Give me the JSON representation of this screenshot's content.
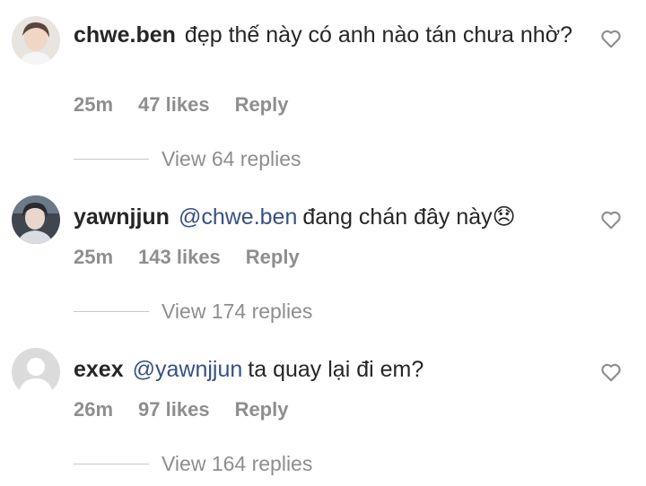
{
  "comments": [
    {
      "username": "chwe.ben",
      "mention": "",
      "text": "đẹp thế này có anh nào tán chưa nhờ?",
      "time": "25m",
      "likes": "47 likes",
      "reply": "Reply",
      "view_replies": "View 64 replies",
      "avatar_icon": "profile-photo"
    },
    {
      "username": "yawnjjun",
      "mention": "@chwe.ben",
      "text": "đang chán đây này😞",
      "time": "25m",
      "likes": "143 likes",
      "reply": "Reply",
      "view_replies": "View 174 replies",
      "avatar_icon": "profile-photo"
    },
    {
      "username": "exex",
      "mention": "@yawnjjun",
      "text": "ta quay lại đi em?",
      "time": "26m",
      "likes": "97 likes",
      "reply": "Reply",
      "view_replies": "View 164 replies",
      "avatar_icon": "default-avatar"
    }
  ],
  "colors": {
    "text": "#262626",
    "secondary": "#8e8e8e",
    "mention": "#385185",
    "divider": "#c7c7c7"
  }
}
